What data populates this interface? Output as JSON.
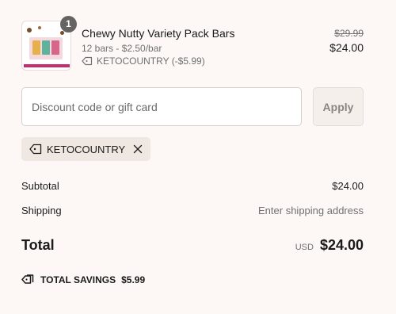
{
  "product": {
    "name": "Chewy Nutty Variety Pack Bars",
    "variant": "12 bars - $2.50/bar",
    "discount_label": "KETOCOUNTRY (-$5.99)",
    "quantity": "1",
    "price_original": "$29.99",
    "price_final": "$24.00",
    "image_icon": "product-thumbnail"
  },
  "discount": {
    "placeholder": "Discount code or gift card",
    "value": "",
    "apply_label": "Apply",
    "applied_code": "KETOCOUNTRY"
  },
  "summary": {
    "subtotal_label": "Subtotal",
    "subtotal_value": "$24.00",
    "shipping_label": "Shipping",
    "shipping_value": "Enter shipping address",
    "total_label": "Total",
    "total_currency": "USD",
    "total_value": "$24.00",
    "savings_label": "TOTAL SAVINGS",
    "savings_value": "$5.99"
  },
  "colors": {
    "background": "#fdf8f5",
    "chip": "#efe7e1",
    "badge": "#666462",
    "muted_text": "#707070"
  }
}
